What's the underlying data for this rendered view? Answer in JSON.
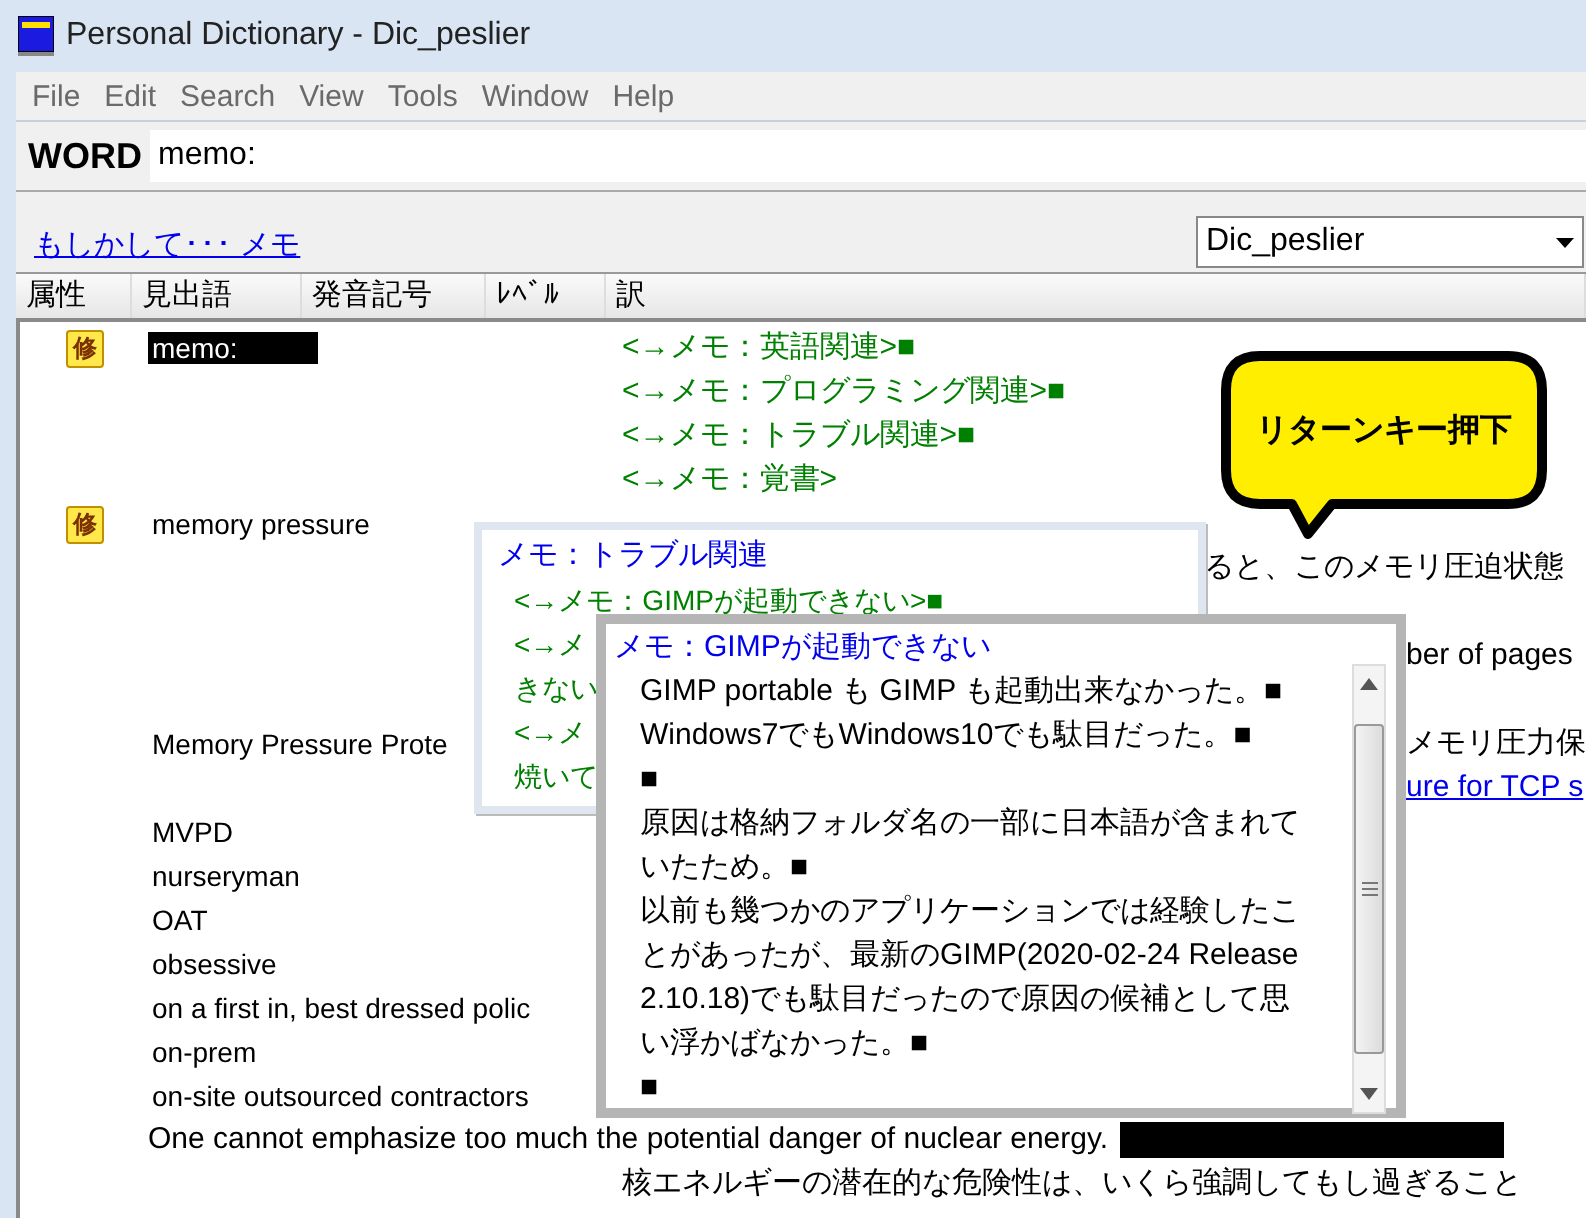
{
  "window": {
    "title": "Personal Dictionary - Dic_peslier"
  },
  "menu": [
    "File",
    "Edit",
    "Search",
    "View",
    "Tools",
    "Window",
    "Help"
  ],
  "search": {
    "label": "WORD",
    "value": "memo:"
  },
  "suggestion": {
    "link": "もしかして･･･ メモ"
  },
  "dictionary_select": {
    "value": "Dic_peslier"
  },
  "columns": [
    "属性",
    "見出語",
    "発音記号",
    "ﾚﾍﾞﾙ",
    "訳"
  ],
  "rows": [
    {
      "kind": "entry",
      "badge": "修",
      "headword": "memo:",
      "selected": true,
      "translations": [
        {
          "kind": "ref",
          "text": "<→メモ：英語関連>■"
        },
        {
          "kind": "ref",
          "text": "<→メモ：プログラミング関連>■"
        },
        {
          "kind": "ref",
          "text": "<→メモ：トラブル関連>■"
        },
        {
          "kind": "ref",
          "text": "<→メモ：覚書>"
        }
      ]
    },
    {
      "kind": "entry",
      "badge": "修",
      "headword": "memory pressure",
      "selected": false,
      "translations": [
        {
          "kind": "blank"
        },
        {
          "kind": "clip",
          "text": "ると、このメモリ圧迫状態"
        },
        {
          "kind": "blank"
        },
        {
          "kind": "cut",
          "text": "ber of pages"
        },
        {
          "kind": "blank"
        }
      ]
    },
    {
      "kind": "entry",
      "headword": "Memory Pressure Prote",
      "selected": false,
      "translations": [
        {
          "kind": "cut",
          "text": "メモリ圧力保"
        },
        {
          "kind": "link",
          "text": "ure for TCP s"
        }
      ]
    },
    {
      "kind": "entry",
      "headword": "MVPD",
      "selected": false
    },
    {
      "kind": "entry",
      "headword": "nurseryman",
      "selected": false
    },
    {
      "kind": "entry",
      "headword": "OAT",
      "selected": false
    },
    {
      "kind": "entry",
      "headword": "obsessive",
      "selected": false
    },
    {
      "kind": "entry",
      "headword": "on a first in, best dressed polic",
      "selected": false
    },
    {
      "kind": "entry",
      "headword": "on-prem",
      "selected": false
    },
    {
      "kind": "entry",
      "headword": "on-site outsourced contractors",
      "selected": false
    },
    {
      "kind": "example",
      "headword": "One cannot emphasize too much the potential danger of nuclear energy.",
      "selected": false,
      "redacted": true,
      "translations": [
        {
          "kind": "plain",
          "text": "核エネルギーの潜在的な危険性は、いくら強調してもし過ぎること"
        }
      ]
    }
  ],
  "callout": {
    "text": "リターンキー押下"
  },
  "popups": [
    {
      "title": "メモ：トラブル関連",
      "lines": [
        "<→メモ：GIMPが起動できない>■",
        "<→メ",
        "きない",
        "<→メ",
        "焼いて"
      ]
    },
    {
      "title": "メモ：GIMPが起動できない",
      "lines": [
        "GIMP portable も GIMP も起動出来なかった。■",
        "Windows7でもWindows10でも駄目だった。■",
        "■",
        "原因は格納フォルダ名の一部に日本語が含まれていたため。■",
        "以前も幾つかのアプリケーションでは経験したことがあったが、最新のGIMP(2020-02-24 Release 2.10.18)でも駄目だったので原因の候補として思い浮かばなかった。■",
        "■"
      ]
    }
  ]
}
